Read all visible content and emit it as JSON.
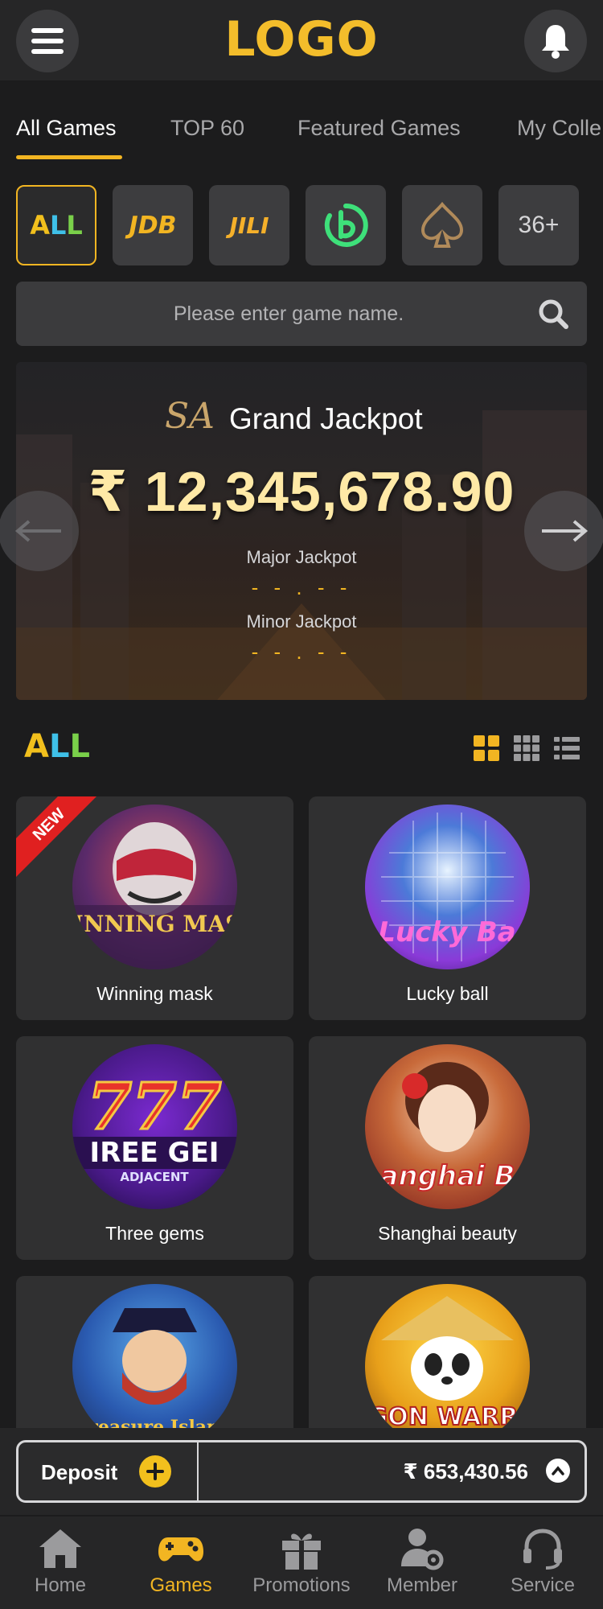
{
  "header": {
    "logo": "LOGO",
    "menu_icon": "hamburger-menu-icon",
    "bell_icon": "bell-icon"
  },
  "tabs": [
    {
      "label": "All Games",
      "active": true
    },
    {
      "label": "TOP 60",
      "active": false
    },
    {
      "label": "Featured Games",
      "active": false
    },
    {
      "label": "My Colle",
      "active": false
    }
  ],
  "providers": {
    "all_a": "A",
    "all_l1": "L",
    "all_l2": "L",
    "jdb": "JDB",
    "jili": "JILI",
    "third_icon": "b-circle-logo-icon",
    "spade_icon": "spade-icon",
    "more": "36+"
  },
  "search": {
    "placeholder": "Please enter game name.",
    "icon": "search-icon"
  },
  "jackpot": {
    "brand": "SA",
    "title": "Grand Jackpot",
    "amount": "₹ 12,345,678.90",
    "major_label": "Major Jackpot",
    "major_value": "- - . - -",
    "minor_label": "Minor Jackpot",
    "minor_value": "- - . - -"
  },
  "section": {
    "title_a": "A",
    "title_l1": "L",
    "title_l2": "L",
    "view_icons": [
      "grid-large-icon",
      "grid-small-icon",
      "list-view-icon"
    ]
  },
  "games": [
    {
      "name": "Winning mask",
      "badge": "NEW",
      "art_text": "WINNING MASK"
    },
    {
      "name": "Lucky ball",
      "art_text": "Lucky Ba"
    },
    {
      "name": "Three gems",
      "art_text": "777 IREE GEI ADJACENT"
    },
    {
      "name": "Shanghai beauty",
      "art_text": "hanghai Be"
    },
    {
      "name": "",
      "art_text": "Treasure Island"
    },
    {
      "name": "",
      "art_text": "AGON WARRIC"
    }
  ],
  "deposit": {
    "label": "Deposit",
    "balance": "₹ 653,430.56"
  },
  "bottom_nav": [
    {
      "label": "Home",
      "icon": "home-icon",
      "active": false
    },
    {
      "label": "Games",
      "icon": "gamepad-icon",
      "active": true
    },
    {
      "label": "Promotions",
      "icon": "gift-icon",
      "active": false
    },
    {
      "label": "Member",
      "icon": "member-settings-icon",
      "active": false
    },
    {
      "label": "Service",
      "icon": "headset-icon",
      "active": false
    }
  ],
  "colors": {
    "accent": "#f2b522",
    "background": "#1c1c1d",
    "card": "#303031"
  }
}
